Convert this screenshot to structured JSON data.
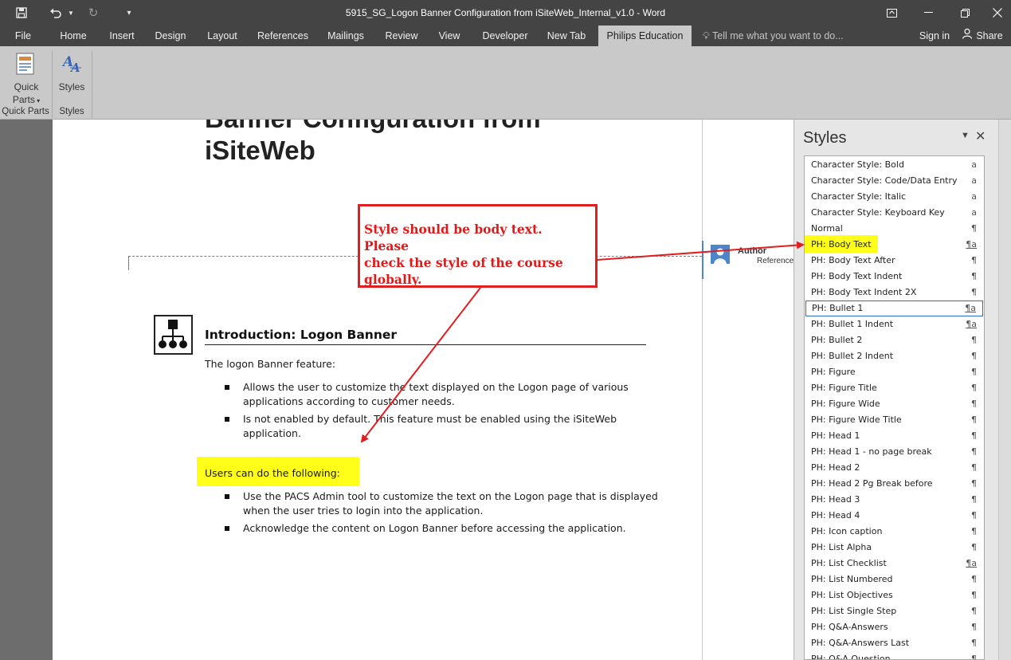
{
  "window": {
    "title": "5915_SG_Logon Banner Configuration from iSiteWeb_Internal_v1.0 - Word",
    "quick_access": [
      "save-icon",
      "undo-icon",
      "undo-dropdown-icon",
      "redo-icon",
      "customize-qat-icon"
    ],
    "controls": [
      "ribbon-display-options-icon",
      "minimize-icon",
      "restore-icon",
      "close-icon"
    ]
  },
  "ribbon_tabs": [
    "File",
    "Home",
    "Insert",
    "Design",
    "Layout",
    "References",
    "Mailings",
    "Review",
    "View",
    "Developer",
    "New Tab",
    "Philips Education"
  ],
  "active_tab": "Philips Education",
  "tell_me": "Tell me what you want to do...",
  "sign_in": "Sign in",
  "share": "Share",
  "ribbon": {
    "quick_parts_line1": "Quick",
    "quick_parts_line2": "Parts",
    "styles_button": "Styles",
    "group1_label": "Quick Parts",
    "group2_label": "Styles"
  },
  "document": {
    "title_line1": "Banner Configuration from",
    "title_line2": "iSiteWeb",
    "side_comment": {
      "label": "Author",
      "sublabel": "Reference"
    },
    "section_heading": "Introduction: Logon Banner",
    "intro": "The logon Banner feature:",
    "bullets1": [
      [
        "Allows the user to customize the text displayed on the Logon page of various",
        "applications according to customer needs."
      ],
      [
        "Is not enabled by default. This feature must be enabled using the iSiteWeb",
        "application."
      ]
    ],
    "users_line": "Users can do the following:",
    "bullets2": [
      [
        "Use the PACS Admin tool to customize the text on the Logon page that is displayed",
        "when the user tries to login into the application."
      ],
      [
        "Acknowledge the content on Logon Banner before accessing the application."
      ]
    ]
  },
  "callout": {
    "line1": "Style should be body text. Please",
    "line2": "check the style of the course",
    "line3": "globally.",
    "color": "#e11919"
  },
  "styles_pane": {
    "title": "Styles",
    "items": [
      {
        "name": "Character Style: Bold",
        "mark": "a"
      },
      {
        "name": "Character Style: Code/Data Entry",
        "mark": "a"
      },
      {
        "name": "Character Style: Italic",
        "mark": "a"
      },
      {
        "name": "Character Style: Keyboard Key",
        "mark": "a"
      },
      {
        "name": "Normal",
        "mark": "¶"
      },
      {
        "name": "PH: Body Text",
        "mark": "¶a"
      },
      {
        "name": "PH: Body Text After",
        "mark": "¶"
      },
      {
        "name": "PH: Body Text Indent",
        "mark": "¶"
      },
      {
        "name": "PH: Body Text Indent 2X",
        "mark": "¶"
      },
      {
        "name": "PH: Bullet 1",
        "mark": "¶a"
      },
      {
        "name": "PH: Bullet 1 Indent",
        "mark": "¶a"
      },
      {
        "name": "PH: Bullet 2",
        "mark": "¶"
      },
      {
        "name": "PH: Bullet 2 Indent",
        "mark": "¶"
      },
      {
        "name": "PH: Figure",
        "mark": "¶"
      },
      {
        "name": "PH: Figure Title",
        "mark": "¶"
      },
      {
        "name": "PH: Figure Wide",
        "mark": "¶"
      },
      {
        "name": "PH: Figure Wide Title",
        "mark": "¶"
      },
      {
        "name": "PH: Head 1",
        "mark": "¶"
      },
      {
        "name": "PH: Head 1 - no page break",
        "mark": "¶"
      },
      {
        "name": "PH: Head 2",
        "mark": "¶"
      },
      {
        "name": "PH: Head 2 Pg Break before",
        "mark": "¶"
      },
      {
        "name": "PH: Head 3",
        "mark": "¶"
      },
      {
        "name": "PH: Head 4",
        "mark": "¶"
      },
      {
        "name": "PH: Icon caption",
        "mark": "¶"
      },
      {
        "name": "PH: List Alpha",
        "mark": "¶"
      },
      {
        "name": "PH: List Checklist",
        "mark": "¶a"
      },
      {
        "name": "PH: List Numbered",
        "mark": "¶"
      },
      {
        "name": "PH: List Objectives",
        "mark": "¶"
      },
      {
        "name": "PH: List Single Step",
        "mark": "¶"
      },
      {
        "name": "PH: Q&A-Answers",
        "mark": "¶"
      },
      {
        "name": "PH: Q&A-Answers Last",
        "mark": "¶"
      },
      {
        "name": "PH: Q&A Question",
        "mark": "¶"
      }
    ],
    "selected": "PH: Bullet 1",
    "highlighted": "PH: Body Text"
  },
  "colors": {
    "highlight": "#ffff19",
    "annotation_red": "#e02020",
    "chrome_dark": "#444444",
    "ribbon": "#c9c9c9"
  }
}
